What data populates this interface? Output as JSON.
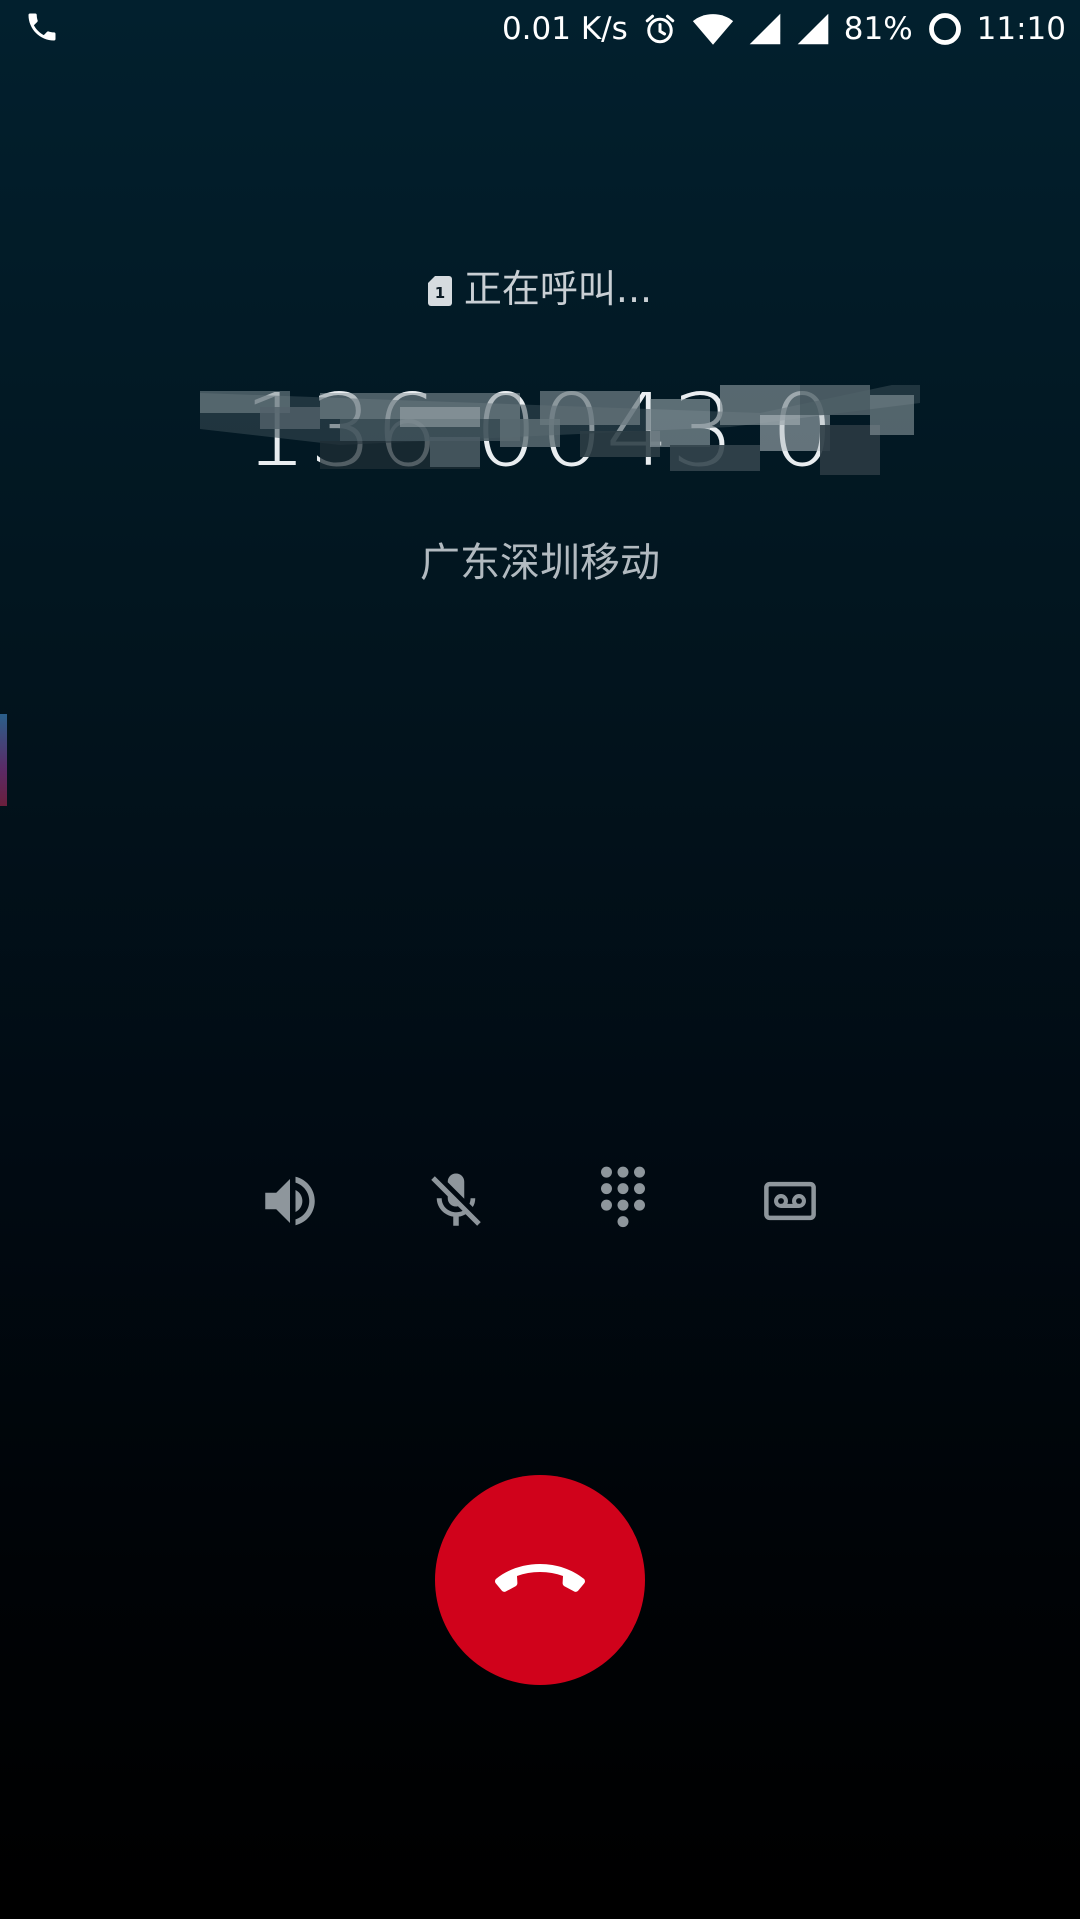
{
  "status_bar": {
    "left_icon": "phone-icon",
    "net_speed": "0.01 K/s",
    "icons": [
      "alarm-icon",
      "wifi-icon",
      "signal-icon",
      "signal-icon"
    ],
    "battery": "81%",
    "battery_icon": "battery-ring-icon",
    "time": "11:10"
  },
  "call": {
    "sim_slot": "1",
    "status": "正在呼叫...",
    "number": "136 0043 0",
    "number_obscured": true,
    "location": "广东深圳移动"
  },
  "controls": [
    {
      "name": "speaker",
      "icon": "speaker-icon"
    },
    {
      "name": "mute",
      "icon": "mic-off-icon"
    },
    {
      "name": "keypad",
      "icon": "dialpad-icon"
    },
    {
      "name": "record",
      "icon": "voicemail-icon"
    }
  ],
  "end_call": {
    "icon": "hangup-icon",
    "color": "#d0021b"
  },
  "colors": {
    "background_top": "#02202e",
    "background_bottom": "#000000",
    "text_primary": "#e9edf0",
    "text_secondary": "#b2bac0",
    "icon_gray": "#8e969c"
  }
}
